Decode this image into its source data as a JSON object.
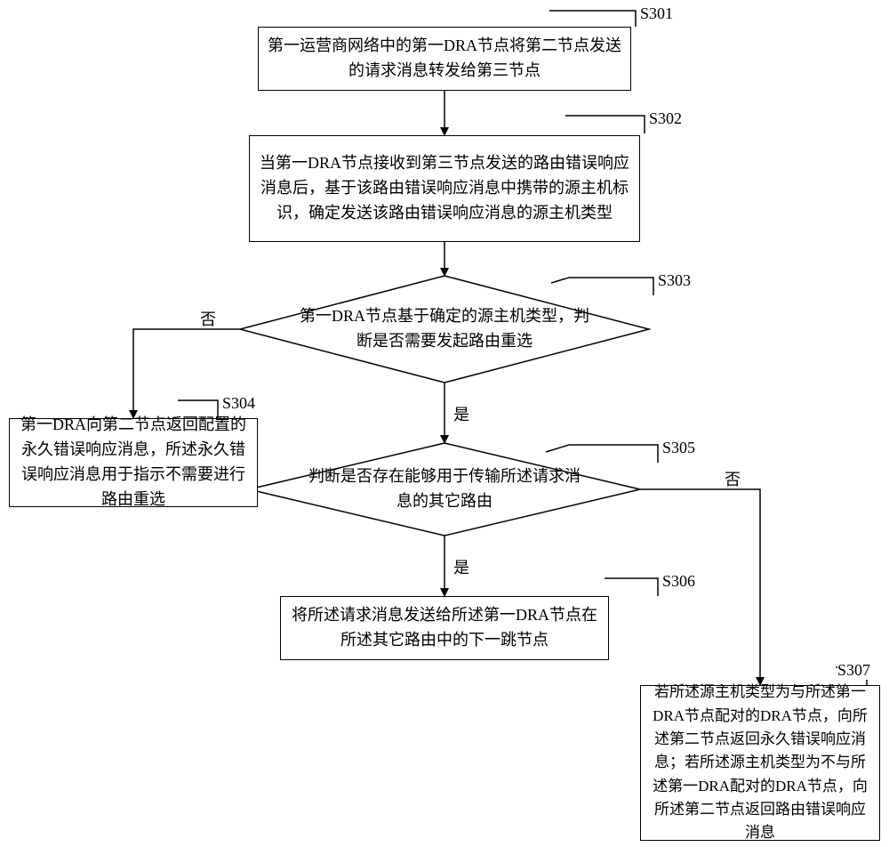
{
  "nodes": {
    "s301": {
      "label": "S301",
      "text": "第一运营商网络中的第一DRA节点将第二节点发送的请求消息转发给第三节点"
    },
    "s302": {
      "label": "S302",
      "text": "当第一DRA节点接收到第三节点发送的路由错误响应消息后，基于该路由错误响应消息中携带的源主机标识，确定发送该路由错误响应消息的源主机类型"
    },
    "s303": {
      "label": "S303",
      "text": "第一DRA节点基于确定的源主机类型，判断是否需要发起路由重选"
    },
    "s304": {
      "label": "S304",
      "text": "第一DRA向第二节点返回配置的永久错误响应消息，所述永久错误响应消息用于指示不需要进行路由重选"
    },
    "s305": {
      "label": "S305",
      "text": "判断是否存在能够用于传输所述请求消息的其它路由"
    },
    "s306": {
      "label": "S306",
      "text": "将所述请求消息发送给所述第一DRA节点在所述其它路由中的下一跳节点"
    },
    "s307": {
      "label": "S307",
      "text": "若所述源主机类型为与所述第一DRA节点配对的DRA节点，向所述第二节点返回永久错误响应消息；若所述源主机类型为不与所述第一DRA配对的DRA节点，向所述第二节点返回路由错误响应消息"
    }
  },
  "edges": {
    "yes": "是",
    "no": "否"
  }
}
